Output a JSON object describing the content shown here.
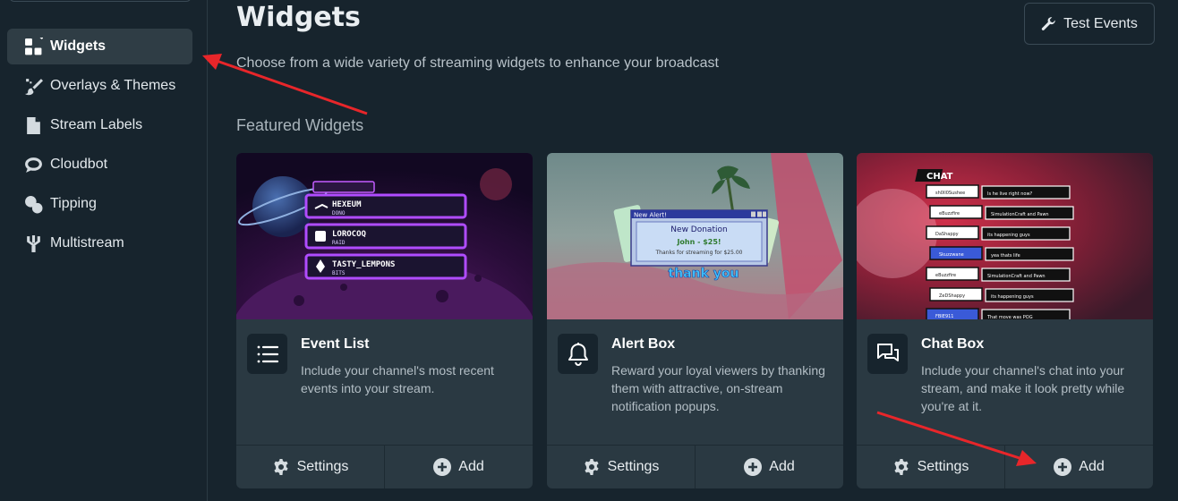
{
  "sidebar": {
    "items": [
      {
        "label": "Widgets",
        "icon": "grid-icon",
        "active": true
      },
      {
        "label": "Overlays & Themes",
        "icon": "brush-icon"
      },
      {
        "label": "Stream Labels",
        "icon": "file-icon"
      },
      {
        "label": "Cloudbot",
        "icon": "chat-bubble-icon"
      },
      {
        "label": "Tipping",
        "icon": "coins-icon"
      },
      {
        "label": "Multistream",
        "icon": "broadcast-tree-icon"
      }
    ]
  },
  "header": {
    "title": "Widgets",
    "subtitle": "Choose from a wide variety of streaming widgets to enhance your broadcast",
    "test_events_label": "Test Events"
  },
  "featured": {
    "title": "Featured Widgets",
    "cards": [
      {
        "title": "Event List",
        "description": "Include your channel's most recent events into your stream.",
        "settings_label": "Settings",
        "add_label": "Add",
        "preview": {
          "rows": [
            {
              "name": "HEXEUM",
              "type": "DONO"
            },
            {
              "name": "LOROCOQ",
              "type": "RAID"
            },
            {
              "name": "TASTY_LEMPONS",
              "type": "BITS"
            }
          ]
        }
      },
      {
        "title": "Alert Box",
        "description": "Reward your loyal viewers by thanking them with attractive, on-stream notification popups.",
        "settings_label": "Settings",
        "add_label": "Add",
        "preview": {
          "window_title": "New Alert!",
          "heading": "New Donation",
          "line1": "John - $25!",
          "line2": "Thanks for streaming for $25.00",
          "thanks": "thank you"
        }
      },
      {
        "title": "Chat Box",
        "description": "Include your channel's chat into your stream, and make it look pretty while you're at it.",
        "settings_label": "Settings",
        "add_label": "Add",
        "preview": {
          "badge": "CHAT",
          "messages": [
            {
              "user": "sh0ll0Sushee",
              "text": "Is he live right now?"
            },
            {
              "user": "eBuzzfire",
              "text": "SimulationCraft and Pawn"
            },
            {
              "user": "DaShappy",
              "text": "its happening guys"
            },
            {
              "user": "Skuzzwane",
              "text": "yea thats life"
            },
            {
              "user": "eBuzzfire",
              "text": "SimulationCraft and Pawn"
            },
            {
              "user": "ZeDShappy",
              "text": "its happening guys"
            },
            {
              "user": "FBIE911",
              "text": "That move was POG"
            }
          ]
        }
      }
    ]
  }
}
